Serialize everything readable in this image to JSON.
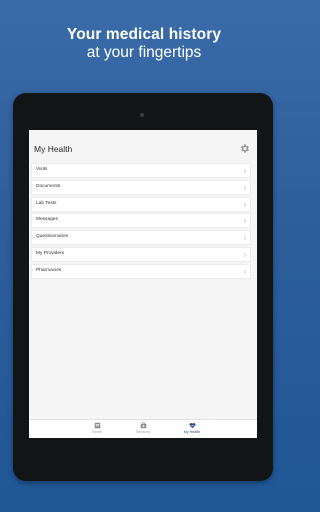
{
  "headline": {
    "line1": "Your medical history",
    "line2": "at your fingertips"
  },
  "screen": {
    "title": "My Health",
    "settings_icon": "gear-icon",
    "menu_items": [
      {
        "label": "Visits"
      },
      {
        "label": "Documents"
      },
      {
        "label": "Lab Tests"
      },
      {
        "label": "Messages"
      },
      {
        "label": "Questionnaires"
      },
      {
        "label": "My Providers"
      },
      {
        "label": "Pharmacies"
      }
    ],
    "tabs": [
      {
        "label": "Home",
        "icon": "home-icon"
      },
      {
        "label": "Services",
        "icon": "medical-bag-icon"
      },
      {
        "label": "My Health",
        "icon": "heart-icon",
        "active": true
      }
    ]
  },
  "colors": {
    "background_top": "#3a6ba8",
    "background_bottom": "#1f5797",
    "tablet_bezel": "#121416",
    "active_tab": "#2a4a7d"
  }
}
